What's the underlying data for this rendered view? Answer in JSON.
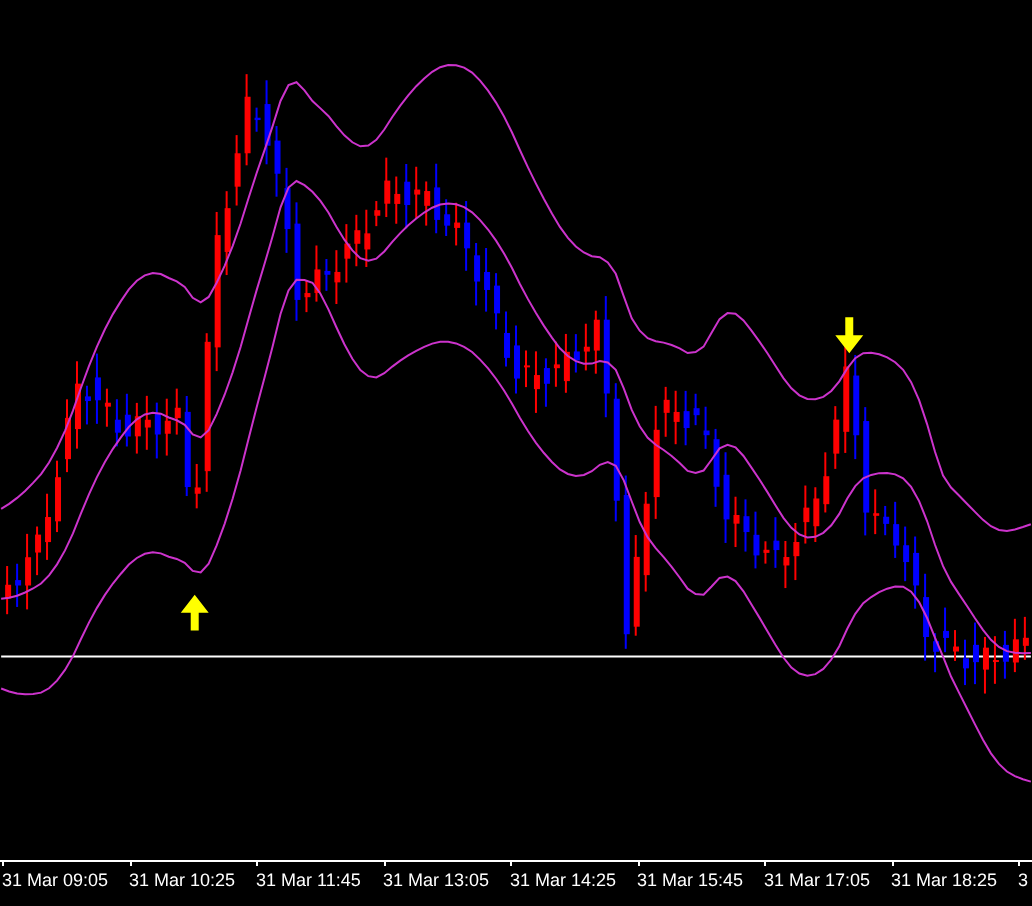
{
  "time_axis": {
    "labels": [
      "31 Mar 09:05",
      "31 Mar 10:25",
      "31 Mar 11:45",
      "31 Mar 13:05",
      "31 Mar 14:25",
      "31 Mar 15:45",
      "31 Mar 17:05",
      "31 Mar 18:25",
      "3"
    ]
  }
}
